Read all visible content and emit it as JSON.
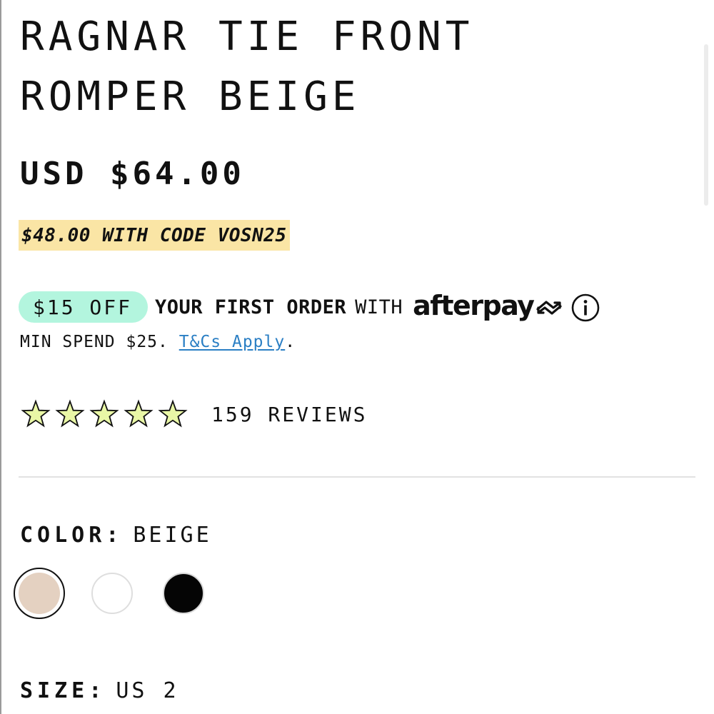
{
  "product": {
    "title_line1": "RAGNAR TIE FRONT",
    "title_line2": "ROMPER BEIGE",
    "price": "USD $64.00",
    "promo": "$48.00 WITH CODE VOSN25"
  },
  "afterpay": {
    "discount_label": "$15 OFF",
    "first_order": "YOUR FIRST ORDER",
    "with": "WITH",
    "brand": "afterpay",
    "min_spend": "MIN SPEND $25.",
    "tcs_link": "T&Cs Apply",
    "period": ".",
    "pill_color": "#b3f5de"
  },
  "rating": {
    "stars": 5,
    "reviews_label": "159 REVIEWS",
    "star_fill": "#e9f7a6"
  },
  "color": {
    "label": "COLOR:",
    "value": "BEIGE",
    "options": [
      {
        "name": "beige",
        "hex": "#e4d1c1",
        "selected": true
      },
      {
        "name": "white",
        "hex": "#ffffff",
        "selected": false
      },
      {
        "name": "black",
        "hex": "#050505",
        "selected": false
      }
    ]
  },
  "size": {
    "label": "SIZE:",
    "value": "US 2"
  },
  "colors": {
    "promo_highlight": "#fae5a5",
    "link": "#2b7fc4",
    "text": "#111111"
  }
}
